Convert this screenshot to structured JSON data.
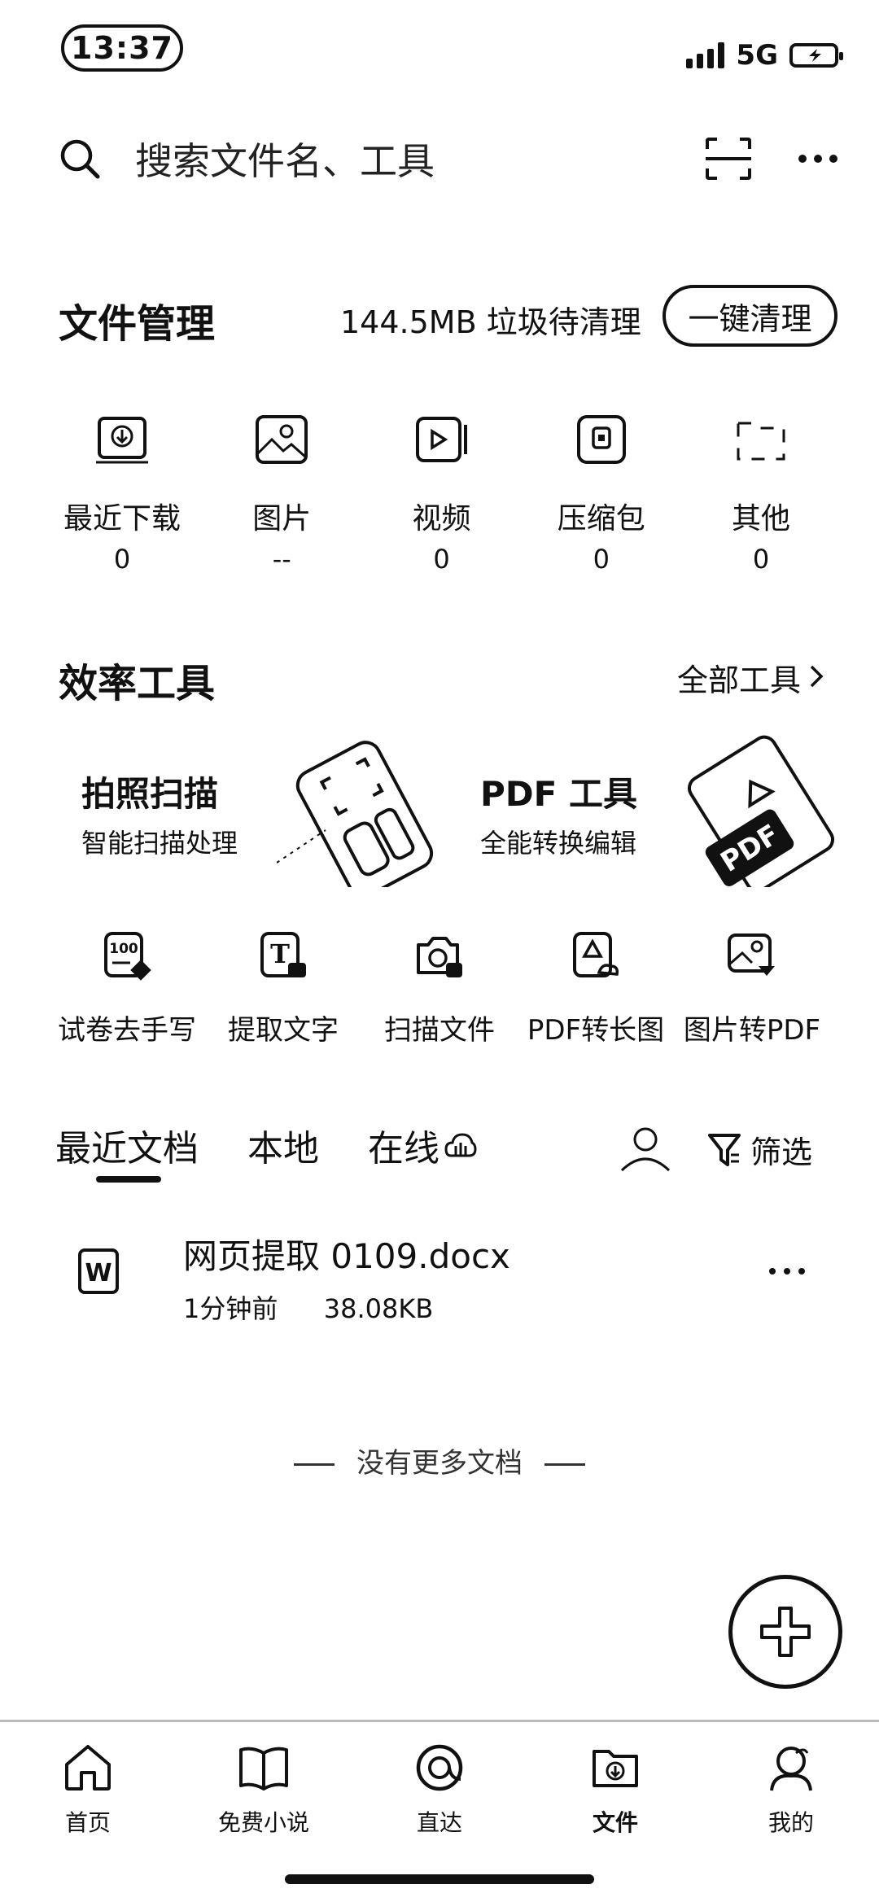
{
  "status_bar": {
    "time": "13:37",
    "network": "5G"
  },
  "search": {
    "placeholder": "搜索文件名、工具"
  },
  "file_management": {
    "title": "文件管理",
    "cleanup_text": "144.5MB 垃圾待清理",
    "cleanup_button": "一键清理",
    "categories": [
      {
        "label": "最近下载",
        "count": "0",
        "icon": "download-folder-icon"
      },
      {
        "label": "图片",
        "count": "--",
        "icon": "image-icon"
      },
      {
        "label": "视频",
        "count": "0",
        "icon": "video-icon"
      },
      {
        "label": "压缩包",
        "count": "0",
        "icon": "zip-icon"
      },
      {
        "label": "其他",
        "count": "0",
        "icon": "folder-icon"
      }
    ]
  },
  "efficiency_tools": {
    "title": "效率工具",
    "all_tools_link": "全部工具",
    "cards": [
      {
        "title": "拍照扫描",
        "subtitle": "智能扫描处理"
      },
      {
        "title": "PDF 工具",
        "subtitle": "全能转换编辑",
        "art_text": "PDF"
      }
    ],
    "tools": [
      {
        "label": "试卷去手写",
        "icon": "exam-paper-icon",
        "icon_text": "100"
      },
      {
        "label": "提取文字",
        "icon": "text-extract-icon",
        "icon_text": "T"
      },
      {
        "label": "扫描文件",
        "icon": "scan-camera-icon"
      },
      {
        "label": "PDF转长图",
        "icon": "pdf-to-image-icon"
      },
      {
        "label": "图片转PDF",
        "icon": "image-to-pdf-icon"
      }
    ]
  },
  "docs": {
    "tabs": [
      {
        "label": "最近文档",
        "active": true
      },
      {
        "label": "本地",
        "active": false
      },
      {
        "label": "在线",
        "active": false
      }
    ],
    "filter_label": "筛选",
    "items": [
      {
        "name": "网页提取 0109.docx",
        "time": "1分钟前",
        "size": "38.08KB",
        "badge": "W"
      }
    ],
    "end_text": "没有更多文档"
  },
  "bottom_nav": [
    {
      "label": "首页",
      "icon": "home-icon"
    },
    {
      "label": "免费小说",
      "icon": "book-icon"
    },
    {
      "label": "直达",
      "icon": "direct-icon"
    },
    {
      "label": "文件",
      "icon": "file-folder-icon",
      "active": true
    },
    {
      "label": "我的",
      "icon": "profile-icon"
    }
  ]
}
